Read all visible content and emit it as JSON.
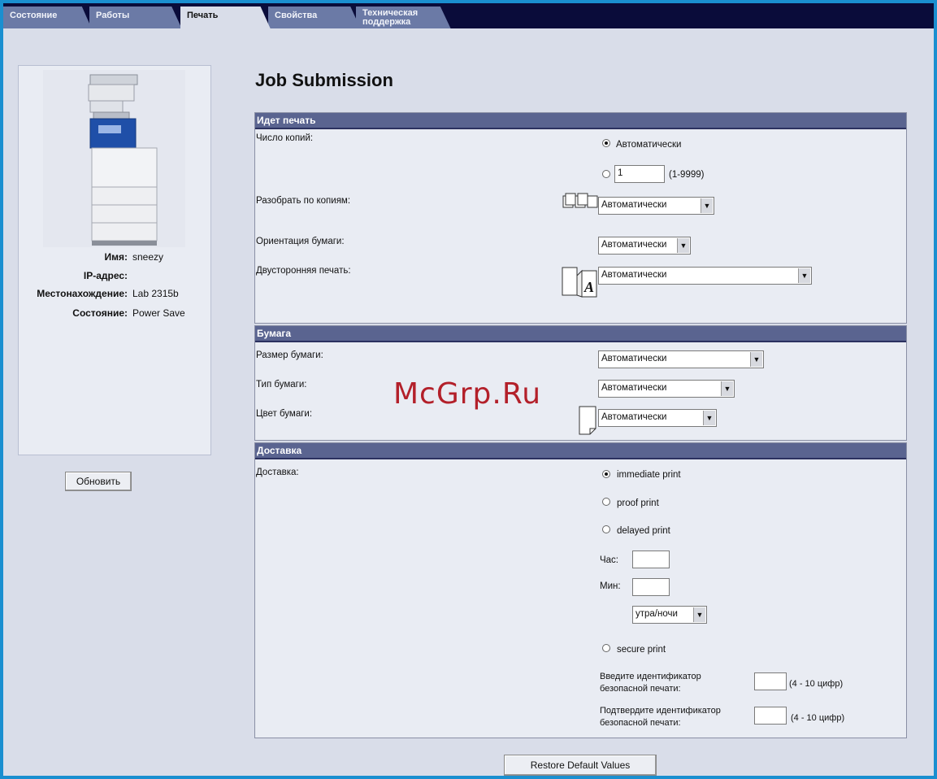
{
  "tabs": [
    {
      "label": "Состояние"
    },
    {
      "label": "Работы"
    },
    {
      "label": "Печать"
    },
    {
      "label": "Свойства"
    },
    {
      "label": "Техническая поддержка"
    }
  ],
  "device": {
    "name_label": "Имя:",
    "name_value": "sneezy",
    "ip_label": "IP-адрес:",
    "ip_value": "",
    "location_label": "Местонахождение:",
    "location_value": "Lab 2315b",
    "status_label": "Состояние:",
    "status_value": "Power Save",
    "refresh_button": "Обновить"
  },
  "page_title": "Job Submission",
  "printing": {
    "header": "Идет печать",
    "copies_label": "Число копий:",
    "copies_auto": "Автоматически",
    "copies_value": "1",
    "copies_range": "(1-9999)",
    "collate_label": "Разобрать по копиям:",
    "collate_value": "Автоматически",
    "orientation_label": "Ориентация бумаги:",
    "orientation_value": "Автоматически",
    "duplex_label": "Двусторонняя печать:",
    "duplex_value": "Автоматически"
  },
  "paper": {
    "header": "Бумага",
    "size_label": "Размер бумаги:",
    "size_value": "Автоматически",
    "type_label": "Тип бумаги:",
    "type_value": "Автоматически",
    "color_label": "Цвет бумаги:",
    "color_value": "Автоматически"
  },
  "delivery": {
    "header": "Доставка",
    "label": "Доставка:",
    "immediate": "immediate print",
    "proof": "proof print",
    "delayed": "delayed print",
    "hour_label": "Час:",
    "min_label": "Мин:",
    "ampm_value": "утра/ночи",
    "secure": "secure print",
    "enter_id_label": "Введите идентификатор безопасной печати:",
    "enter_id_hint": "(4 - 10 цифр)",
    "confirm_id_label": "Подтвердите идентификатор безопасной печати:",
    "confirm_id_hint": "(4 - 10 цифр)"
  },
  "restore_button": "Restore Default Values",
  "watermark": "McGrp.Ru",
  "colors": {
    "accent": "#5a6490",
    "frame": "#1a8fd0",
    "tabbar": "#0a0c3a"
  }
}
